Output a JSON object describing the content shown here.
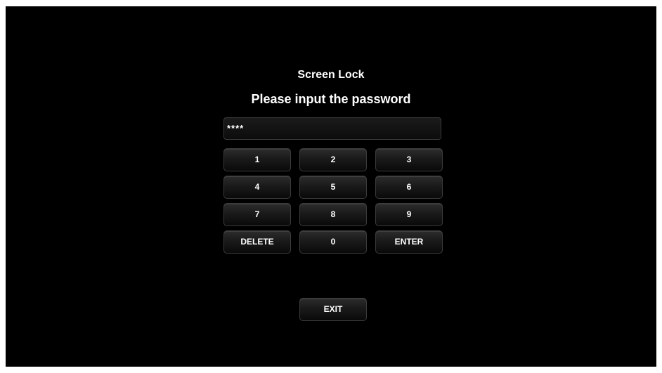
{
  "lock": {
    "title": "Screen Lock",
    "prompt": "Please input the password",
    "password_value": "****"
  },
  "keypad": {
    "k1": "1",
    "k2": "2",
    "k3": "3",
    "k4": "4",
    "k5": "5",
    "k6": "6",
    "k7": "7",
    "k8": "8",
    "k9": "9",
    "delete": "DELETE",
    "k0": "0",
    "enter": "ENTER"
  },
  "exit_label": "EXIT",
  "colors": {
    "background": "#000000",
    "text": "#ffffff",
    "key_border": "#3b3b3b"
  }
}
